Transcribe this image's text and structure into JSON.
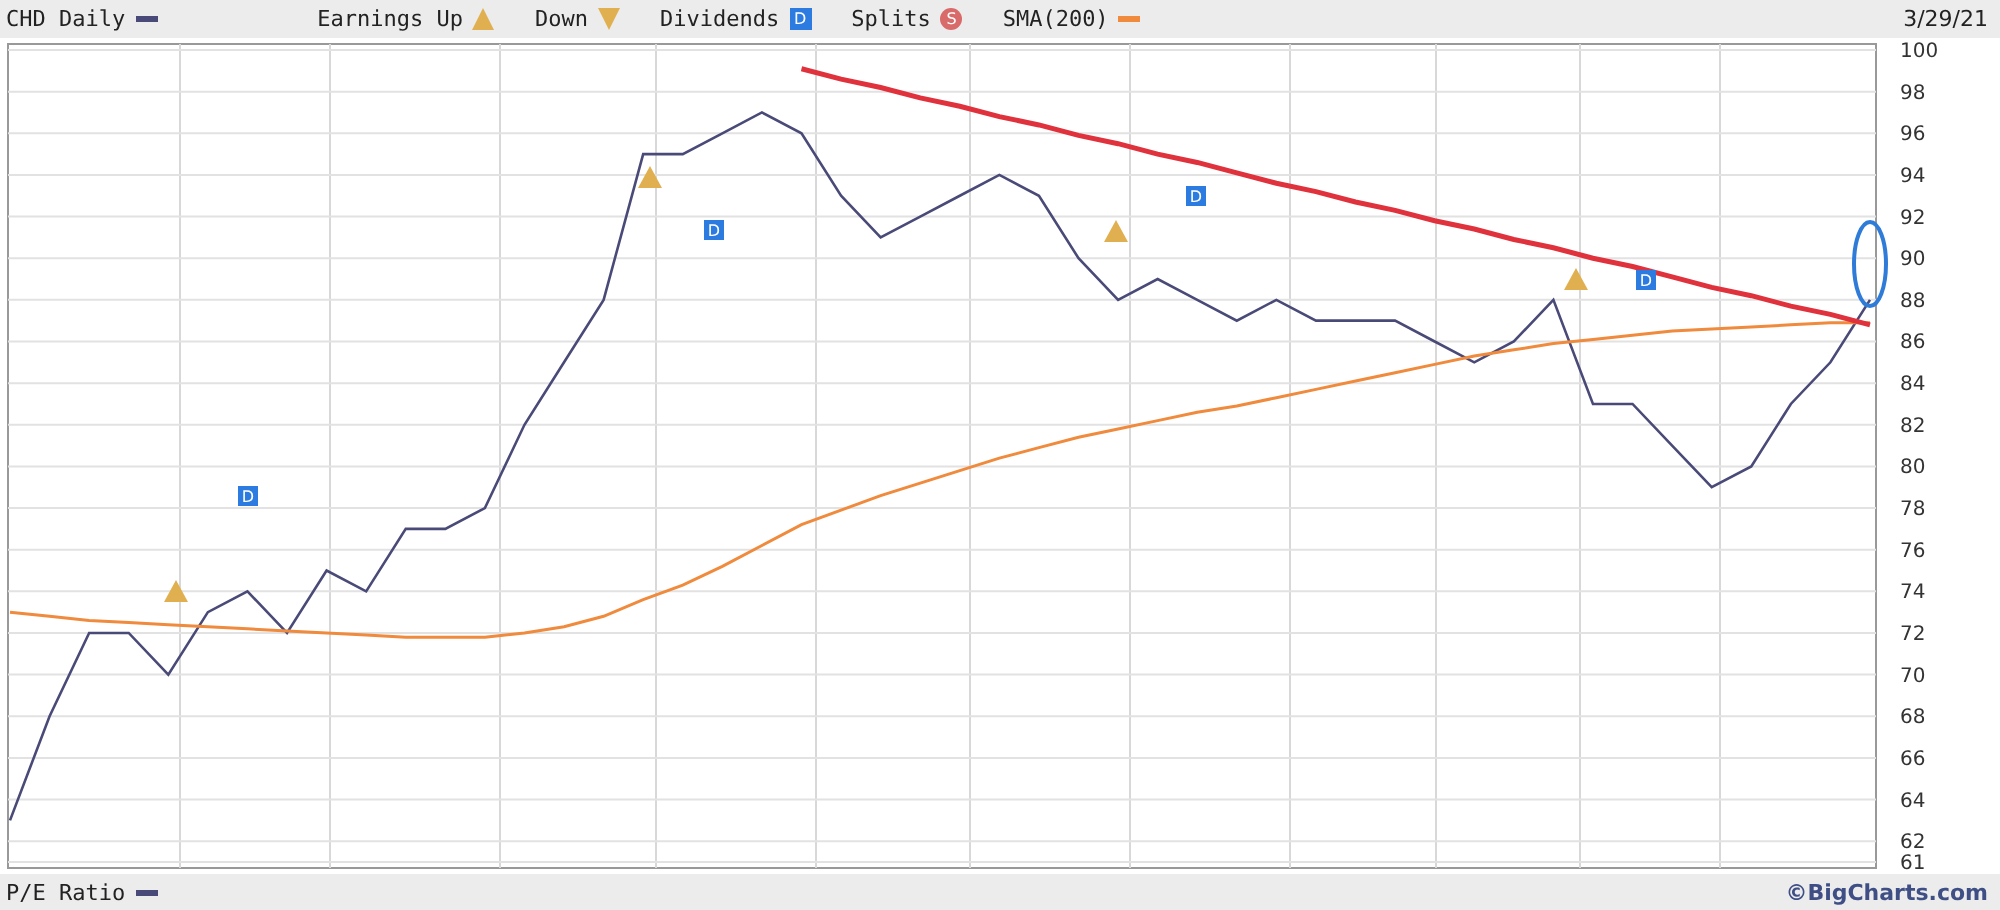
{
  "header": {
    "legend": [
      {
        "kind": "earnings_up",
        "label": "Earnings Up"
      },
      {
        "kind": "earnings_down",
        "label": "Down"
      },
      {
        "kind": "dividend",
        "label": "Dividends",
        "glyph": "D"
      },
      {
        "kind": "split",
        "label": "Splits",
        "glyph": "S"
      }
    ],
    "date": "3/29/21"
  },
  "chart": {
    "chart_data": {
      "type": "line",
      "grid": true,
      "yticks": [
        61,
        62,
        64,
        66,
        68,
        70,
        72,
        74,
        76,
        78,
        80,
        82,
        84,
        86,
        88,
        90,
        92,
        94,
        96,
        98,
        100
      ],
      "ylim": [
        61,
        100
      ],
      "series": [
        {
          "name": "CHD Daily",
          "color": "#4a4a78",
          "values": [
            63,
            68,
            72,
            72,
            70,
            73,
            74,
            72,
            75,
            74,
            77,
            77,
            78,
            82,
            85,
            88,
            95,
            95,
            96,
            97,
            96,
            93,
            91,
            92,
            93,
            94,
            93,
            90,
            88,
            89,
            88,
            87,
            88,
            87,
            87,
            87,
            86,
            85,
            86,
            88,
            83,
            83,
            81,
            79,
            80,
            83,
            85,
            88
          ]
        },
        {
          "name": "SMA(200)",
          "color": "#f08a3c",
          "values": [
            73.0,
            72.8,
            72.6,
            72.5,
            72.4,
            72.3,
            72.2,
            72.1,
            72.0,
            71.9,
            71.8,
            71.8,
            71.8,
            72.0,
            72.3,
            72.8,
            73.6,
            74.3,
            75.2,
            76.2,
            77.2,
            77.9,
            78.6,
            79.2,
            79.8,
            80.4,
            80.9,
            81.4,
            81.8,
            82.2,
            82.6,
            82.9,
            83.3,
            83.7,
            84.1,
            84.5,
            84.9,
            85.3,
            85.6,
            85.9,
            86.1,
            86.3,
            86.5,
            86.6,
            86.7,
            86.8,
            86.9,
            86.9
          ]
        },
        {
          "color": "#e0323c",
          "values": [
            null,
            null,
            null,
            null,
            null,
            null,
            null,
            null,
            null,
            null,
            null,
            null,
            null,
            null,
            null,
            null,
            null,
            null,
            null,
            null,
            99.1,
            98.6,
            98.2,
            97.7,
            97.3,
            96.8,
            96.4,
            95.9,
            95.5,
            95.0,
            94.6,
            94.1,
            93.6,
            93.2,
            92.7,
            92.3,
            91.8,
            91.4,
            90.9,
            90.5,
            90.0,
            89.6,
            89.1,
            88.6,
            88.2,
            87.7,
            87.3,
            86.8
          ]
        }
      ]
    },
    "overlays": [
      {
        "kind": "ellipse"
      }
    ],
    "markers": [
      {
        "kind": "earnings_up"
      },
      {
        "kind": "dividend",
        "glyph": "D"
      },
      {
        "kind": "earnings_up"
      },
      {
        "kind": "dividend",
        "glyph": "D"
      },
      {
        "kind": "earnings_up"
      },
      {
        "kind": "dividend",
        "glyph": "D"
      },
      {
        "kind": "earnings_up"
      },
      {
        "kind": "dividend",
        "glyph": "D"
      }
    ]
  },
  "footer": {
    "legend": [
      {
        "kind": "series",
        "label": "P/E Ratio"
      }
    ],
    "credit": "©BigCharts.com"
  }
}
